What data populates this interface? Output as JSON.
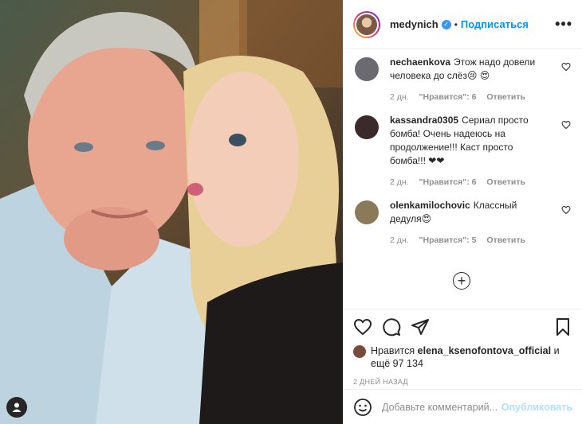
{
  "post": {
    "username": "medynich",
    "follow_label": "Подписаться",
    "dot": "•"
  },
  "comments": [
    {
      "user": "nechaenkova",
      "text": "Этож надо довели человека до слёз😢 😍",
      "time": "2 дн.",
      "likes": "\"Нравится\": 6",
      "reply": "Ответить",
      "avatar_color": "#6a6a70"
    },
    {
      "user": "kassandra0305",
      "text": "Сериал просто бомба! Очень надеюсь на продолжение!!! Каст просто бомба!!! ❤❤",
      "time": "2 дн.",
      "likes": "\"Нравится\": 6",
      "reply": "Ответить",
      "avatar_color": "#3a2a2a"
    },
    {
      "user": "olenkamilochovic",
      "text": "Классный дедуля😍",
      "time": "2 дн.",
      "likes": "\"Нравится\": 5",
      "reply": "Ответить",
      "avatar_color": "#8a7a5a"
    }
  ],
  "load_more": "+",
  "likes_summary": {
    "prefix": "Нравится",
    "user": "elena_ksenofontova_official",
    "suffix": "и ещё 97 134"
  },
  "time_ago": "2 ДНЕЙ НАЗАД",
  "comment_box": {
    "placeholder": "Добавьте комментарий...",
    "post_label": "Опубликовать"
  },
  "more_label": "•••",
  "colors": {
    "accent": "#0095f6",
    "muted": "#8e8e8e"
  }
}
